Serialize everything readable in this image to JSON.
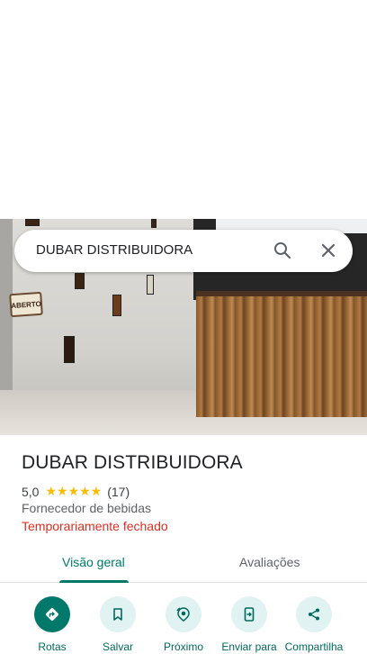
{
  "search": {
    "query": "DUBAR DISTRIBUIDORA",
    "search_icon": "search-icon",
    "close_icon": "close-icon"
  },
  "photo": {
    "sign_text": "ABERTO"
  },
  "place": {
    "name": "DUBAR DISTRIBUIDORA",
    "rating": "5,0",
    "stars": "★★★★★",
    "reviews_count": "(17)",
    "category": "Fornecedor de bebidas",
    "status": "Temporariamente fechado"
  },
  "tabs": [
    {
      "label": "Visão geral",
      "active": true
    },
    {
      "label": "Avaliações",
      "active": false
    }
  ],
  "actions": [
    {
      "label": "Rotas",
      "icon": "directions-icon"
    },
    {
      "label": "Salvar",
      "icon": "bookmark-icon"
    },
    {
      "label": "Próximo",
      "icon": "nearby-icon"
    },
    {
      "label": "Enviar para",
      "icon": "send-to-phone-icon"
    },
    {
      "label": "Compartilha",
      "icon": "share-icon"
    }
  ],
  "colors": {
    "accent": "#00796b",
    "status_closed": "#d93025",
    "star": "#fbbc04"
  }
}
